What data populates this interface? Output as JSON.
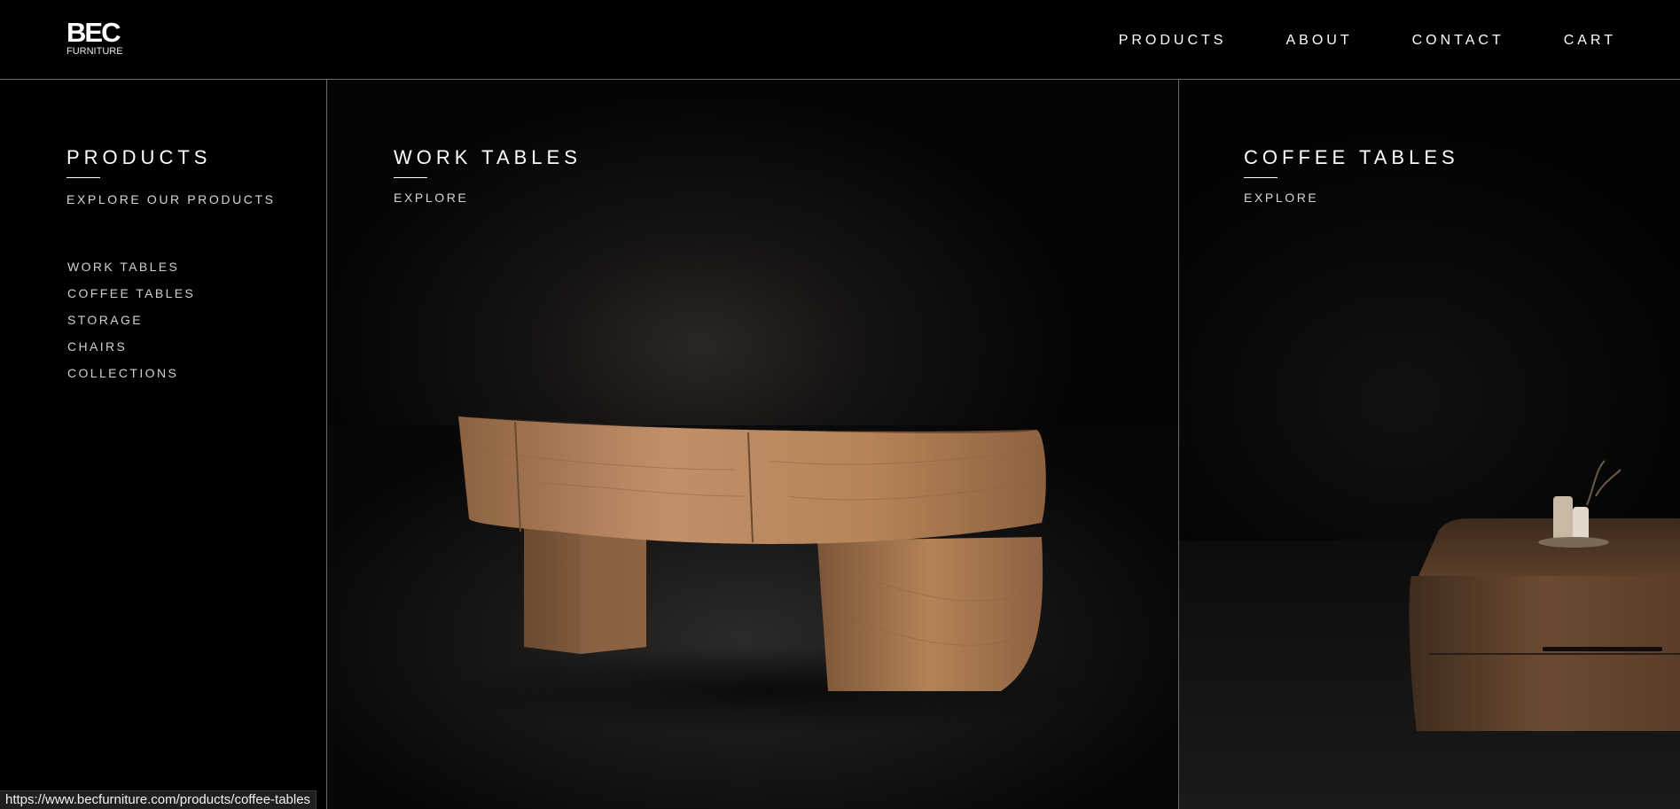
{
  "header": {
    "logo_main": "BEC",
    "logo_sub": "FURNITURE",
    "nav": [
      {
        "label": "PRODUCTS"
      },
      {
        "label": "ABOUT"
      },
      {
        "label": "CONTACT"
      },
      {
        "label": "CART"
      }
    ]
  },
  "products_menu": {
    "title": "PRODUCTS",
    "subtitle": "EXPLORE OUR PRODUCTS",
    "items": [
      {
        "label": "WORK TABLES"
      },
      {
        "label": "COFFEE TABLES"
      },
      {
        "label": "STORAGE"
      },
      {
        "label": "CHAIRS"
      },
      {
        "label": "COLLECTIONS"
      }
    ]
  },
  "work_tables_panel": {
    "title": "WORK TABLES",
    "link": "EXPLORE",
    "image_icon": "work-table-photo"
  },
  "coffee_tables_panel": {
    "title": "COFFEE TABLES",
    "link": "EXPLORE",
    "image_icon": "coffee-table-photo"
  },
  "status_bar": {
    "url": "https://www.becfurniture.com/products/coffee-tables"
  },
  "colors": {
    "background": "#000000",
    "divider": "#6a6a6a",
    "text": "#ffffff",
    "wood": "#b88658"
  }
}
